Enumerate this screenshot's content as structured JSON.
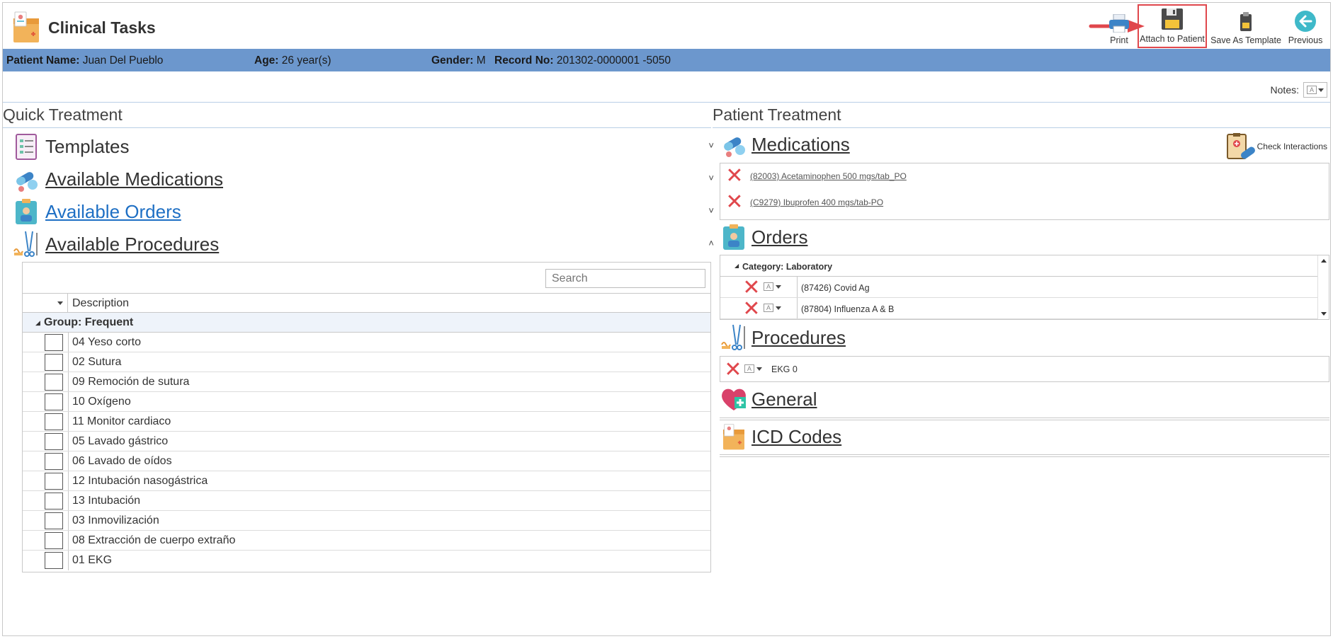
{
  "app": {
    "title": "Clinical Tasks"
  },
  "toolbar": {
    "print": "Print",
    "attach": "Attach to Patient",
    "save_template": "Save As Template",
    "previous": "Previous"
  },
  "patient": {
    "name_label": "Patient Name:",
    "name": "Juan Del Pueblo",
    "age_label": "Age:",
    "age": "26 year(s)",
    "gender_label": "Gender:",
    "gender": "M",
    "record_label": "Record No:",
    "record": "201302-0000001 -5050"
  },
  "notes": {
    "label": "Notes:"
  },
  "quick_treatment": {
    "title": "Quick Treatment",
    "sections": [
      {
        "label": "Templates",
        "chevron": "˅"
      },
      {
        "label": "Available Medications",
        "chevron": "˅"
      },
      {
        "label": "Available Orders",
        "chevron": "˅"
      },
      {
        "label": "Available Procedures",
        "chevron": "˄"
      }
    ],
    "procedures_grid": {
      "search_placeholder": "Search",
      "column_description": "Description",
      "group_label": "Group: Frequent",
      "rows": [
        "04 Yeso corto",
        "02 Sutura",
        "09 Remoción de sutura",
        "10 Oxígeno",
        "11 Monitor cardiaco",
        "05 Lavado gástrico",
        "06 Lavado de oídos",
        "12 Intubación nasogástrica",
        "13 Intubación",
        "03 Inmovilización",
        "08 Extracción de cuerpo extraño",
        "01 EKG"
      ]
    }
  },
  "patient_treatment": {
    "title": "Patient Treatment",
    "check_interactions": "Check Interactions",
    "medications": {
      "label": "Medications",
      "items": [
        "(82003) Acetaminophen 500 mgs/tab_PO",
        "(C9279) Ibuprofen 400 mgs/tab-PO"
      ]
    },
    "orders": {
      "label": "Orders",
      "category": "Category: Laboratory",
      "items": [
        "(87426) Covid Ag",
        "(87804) Influenza A & B"
      ]
    },
    "procedures": {
      "label": "Procedures",
      "items": [
        "EKG 0"
      ]
    },
    "general": {
      "label": "General"
    },
    "icd": {
      "label": "ICD Codes"
    }
  },
  "colors": {
    "patient_bar": "#6c97cd",
    "delete_red": "#e0474c",
    "highlight_border": "#e0474c",
    "link_blue": "#1e6fc4",
    "previous_button": "#3fb9c9"
  }
}
